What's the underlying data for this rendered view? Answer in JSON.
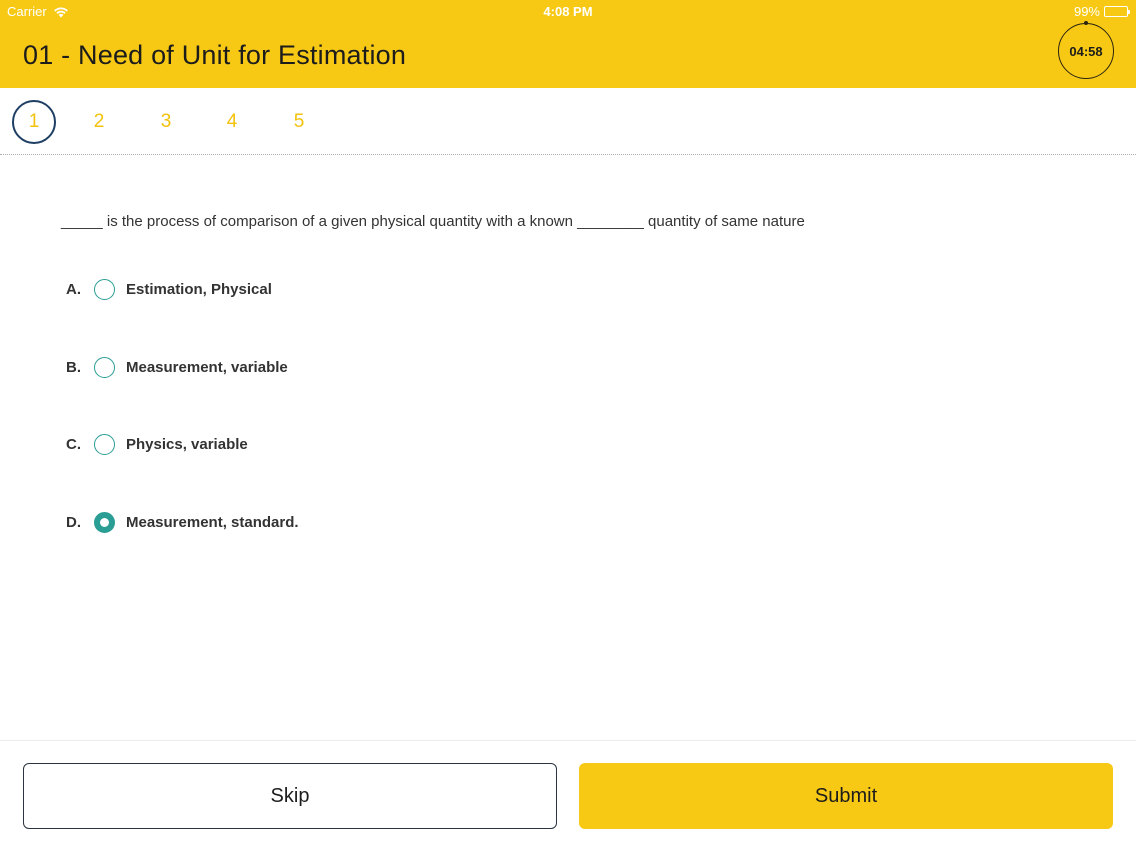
{
  "status_bar": {
    "carrier": "Carrier",
    "time": "4:08 PM",
    "battery": "99%"
  },
  "header": {
    "title": "01 - Need of Unit for Estimation",
    "timer": "04:58"
  },
  "question_nav": {
    "tabs": [
      "1",
      "2",
      "3",
      "4",
      "5"
    ],
    "active_index": 0
  },
  "question": {
    "text": "_____ is the process of comparison of a given physical quantity with a known ________ quantity of same nature",
    "options": [
      {
        "letter": "A.",
        "text": "Estimation, Physical",
        "selected": false
      },
      {
        "letter": "B.",
        "text": "Measurement, variable",
        "selected": false
      },
      {
        "letter": "C.",
        "text": "Physics, variable",
        "selected": false
      },
      {
        "letter": "D.",
        "text": "Measurement, standard.",
        "selected": true
      }
    ]
  },
  "footer": {
    "skip_label": "Skip",
    "submit_label": "Submit"
  },
  "colors": {
    "accent": "#f7c915",
    "radio": "#2a9d94",
    "active_tab_ring": "#1f3e63"
  },
  "icons": {
    "wifi": "wifi-icon",
    "battery": "battery-icon",
    "radio_selected": "radio-checked-icon",
    "radio_unselected": "radio-unchecked-icon"
  }
}
